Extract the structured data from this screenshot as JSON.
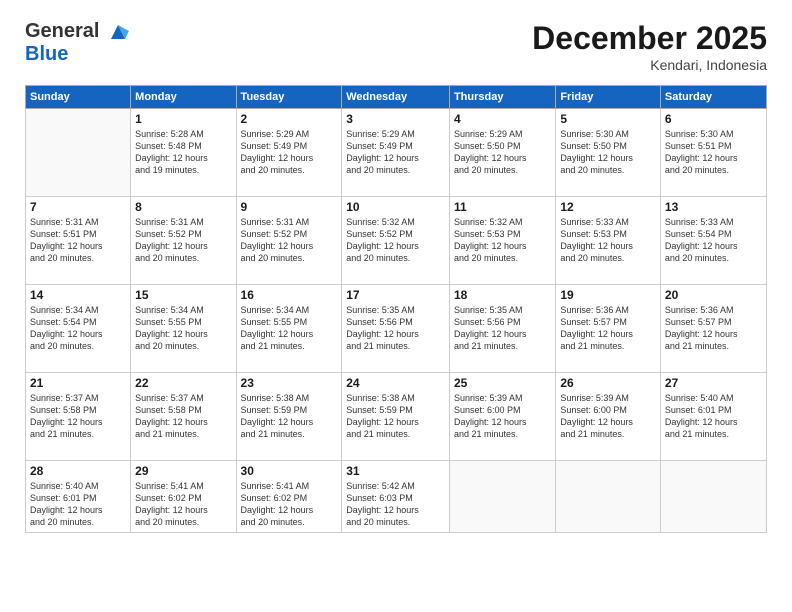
{
  "header": {
    "logo_line1": "General",
    "logo_line2": "Blue",
    "month_year": "December 2025",
    "location": "Kendari, Indonesia"
  },
  "weekdays": [
    "Sunday",
    "Monday",
    "Tuesday",
    "Wednesday",
    "Thursday",
    "Friday",
    "Saturday"
  ],
  "weeks": [
    [
      {
        "day": "",
        "info": ""
      },
      {
        "day": "1",
        "info": "Sunrise: 5:28 AM\nSunset: 5:48 PM\nDaylight: 12 hours\nand 19 minutes."
      },
      {
        "day": "2",
        "info": "Sunrise: 5:29 AM\nSunset: 5:49 PM\nDaylight: 12 hours\nand 20 minutes."
      },
      {
        "day": "3",
        "info": "Sunrise: 5:29 AM\nSunset: 5:49 PM\nDaylight: 12 hours\nand 20 minutes."
      },
      {
        "day": "4",
        "info": "Sunrise: 5:29 AM\nSunset: 5:50 PM\nDaylight: 12 hours\nand 20 minutes."
      },
      {
        "day": "5",
        "info": "Sunrise: 5:30 AM\nSunset: 5:50 PM\nDaylight: 12 hours\nand 20 minutes."
      },
      {
        "day": "6",
        "info": "Sunrise: 5:30 AM\nSunset: 5:51 PM\nDaylight: 12 hours\nand 20 minutes."
      }
    ],
    [
      {
        "day": "7",
        "info": "Sunrise: 5:31 AM\nSunset: 5:51 PM\nDaylight: 12 hours\nand 20 minutes."
      },
      {
        "day": "8",
        "info": "Sunrise: 5:31 AM\nSunset: 5:52 PM\nDaylight: 12 hours\nand 20 minutes."
      },
      {
        "day": "9",
        "info": "Sunrise: 5:31 AM\nSunset: 5:52 PM\nDaylight: 12 hours\nand 20 minutes."
      },
      {
        "day": "10",
        "info": "Sunrise: 5:32 AM\nSunset: 5:52 PM\nDaylight: 12 hours\nand 20 minutes."
      },
      {
        "day": "11",
        "info": "Sunrise: 5:32 AM\nSunset: 5:53 PM\nDaylight: 12 hours\nand 20 minutes."
      },
      {
        "day": "12",
        "info": "Sunrise: 5:33 AM\nSunset: 5:53 PM\nDaylight: 12 hours\nand 20 minutes."
      },
      {
        "day": "13",
        "info": "Sunrise: 5:33 AM\nSunset: 5:54 PM\nDaylight: 12 hours\nand 20 minutes."
      }
    ],
    [
      {
        "day": "14",
        "info": "Sunrise: 5:34 AM\nSunset: 5:54 PM\nDaylight: 12 hours\nand 20 minutes."
      },
      {
        "day": "15",
        "info": "Sunrise: 5:34 AM\nSunset: 5:55 PM\nDaylight: 12 hours\nand 20 minutes."
      },
      {
        "day": "16",
        "info": "Sunrise: 5:34 AM\nSunset: 5:55 PM\nDaylight: 12 hours\nand 21 minutes."
      },
      {
        "day": "17",
        "info": "Sunrise: 5:35 AM\nSunset: 5:56 PM\nDaylight: 12 hours\nand 21 minutes."
      },
      {
        "day": "18",
        "info": "Sunrise: 5:35 AM\nSunset: 5:56 PM\nDaylight: 12 hours\nand 21 minutes."
      },
      {
        "day": "19",
        "info": "Sunrise: 5:36 AM\nSunset: 5:57 PM\nDaylight: 12 hours\nand 21 minutes."
      },
      {
        "day": "20",
        "info": "Sunrise: 5:36 AM\nSunset: 5:57 PM\nDaylight: 12 hours\nand 21 minutes."
      }
    ],
    [
      {
        "day": "21",
        "info": "Sunrise: 5:37 AM\nSunset: 5:58 PM\nDaylight: 12 hours\nand 21 minutes."
      },
      {
        "day": "22",
        "info": "Sunrise: 5:37 AM\nSunset: 5:58 PM\nDaylight: 12 hours\nand 21 minutes."
      },
      {
        "day": "23",
        "info": "Sunrise: 5:38 AM\nSunset: 5:59 PM\nDaylight: 12 hours\nand 21 minutes."
      },
      {
        "day": "24",
        "info": "Sunrise: 5:38 AM\nSunset: 5:59 PM\nDaylight: 12 hours\nand 21 minutes."
      },
      {
        "day": "25",
        "info": "Sunrise: 5:39 AM\nSunset: 6:00 PM\nDaylight: 12 hours\nand 21 minutes."
      },
      {
        "day": "26",
        "info": "Sunrise: 5:39 AM\nSunset: 6:00 PM\nDaylight: 12 hours\nand 21 minutes."
      },
      {
        "day": "27",
        "info": "Sunrise: 5:40 AM\nSunset: 6:01 PM\nDaylight: 12 hours\nand 21 minutes."
      }
    ],
    [
      {
        "day": "28",
        "info": "Sunrise: 5:40 AM\nSunset: 6:01 PM\nDaylight: 12 hours\nand 20 minutes."
      },
      {
        "day": "29",
        "info": "Sunrise: 5:41 AM\nSunset: 6:02 PM\nDaylight: 12 hours\nand 20 minutes."
      },
      {
        "day": "30",
        "info": "Sunrise: 5:41 AM\nSunset: 6:02 PM\nDaylight: 12 hours\nand 20 minutes."
      },
      {
        "day": "31",
        "info": "Sunrise: 5:42 AM\nSunset: 6:03 PM\nDaylight: 12 hours\nand 20 minutes."
      },
      {
        "day": "",
        "info": ""
      },
      {
        "day": "",
        "info": ""
      },
      {
        "day": "",
        "info": ""
      }
    ]
  ]
}
